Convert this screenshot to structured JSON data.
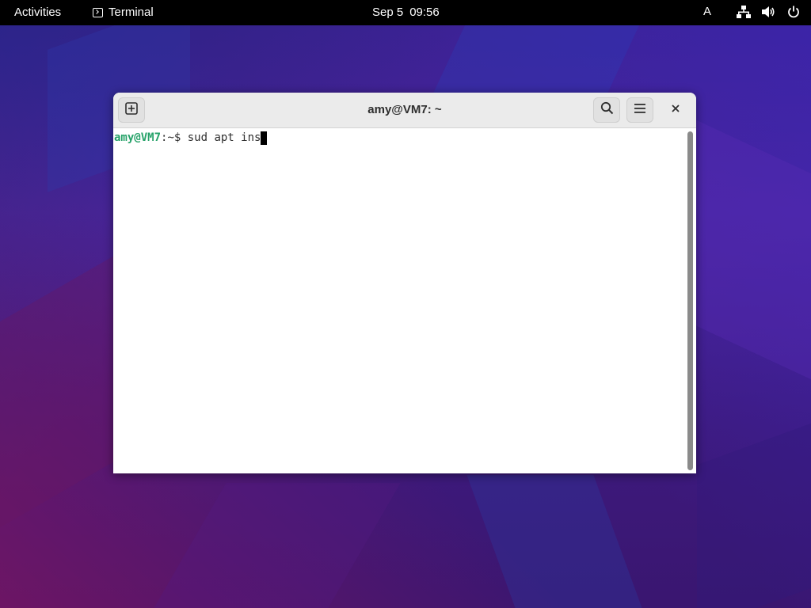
{
  "topbar": {
    "activities_label": "Activities",
    "app_name": "Terminal",
    "date": "Sep 5",
    "time": "09:56",
    "input_source": "A",
    "icons": [
      "network-icon",
      "volume-icon",
      "power-icon"
    ]
  },
  "window": {
    "title": "amy@VM7: ~",
    "buttons": [
      "new-tab-icon",
      "search-icon",
      "hamburger-menu-icon",
      "close-icon"
    ]
  },
  "terminal": {
    "prompt_user_host": "amy@VM7",
    "prompt_path": ":~$ ",
    "command": "sud apt ins"
  },
  "colors": {
    "topbar_bg": "#000000",
    "prompt_green": "#26a269",
    "terminal_bg": "#ffffff",
    "headerbar_bg": "#ebebeb"
  }
}
